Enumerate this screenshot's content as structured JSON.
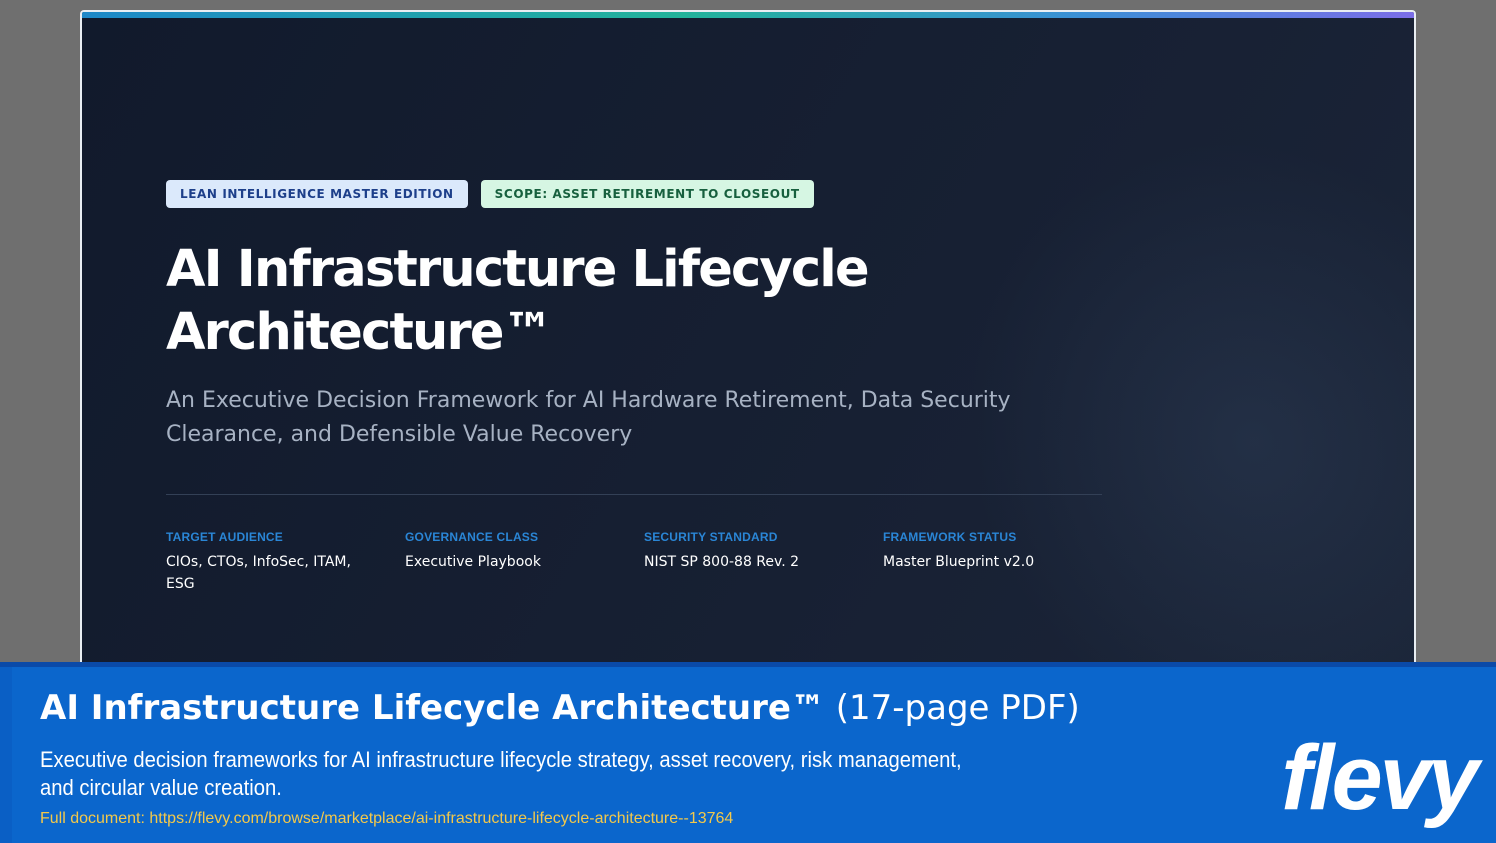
{
  "slide": {
    "tags": [
      {
        "label": "LEAN INTELLIGENCE MASTER EDITION"
      },
      {
        "label": "SCOPE: ASSET RETIREMENT TO CLOSEOUT"
      }
    ],
    "title_line1": "AI Infrastructure Lifecycle",
    "title_line2": "Architecture™",
    "subtitle": "An Executive Decision Framework for AI Hardware Retirement, Data Security Clearance, and Defensible Value Recovery",
    "meta": [
      {
        "label": "TARGET AUDIENCE",
        "value": "CIOs, CTOs, InfoSec, ITAM, ESG"
      },
      {
        "label": "GOVERNANCE CLASS",
        "value": "Executive Playbook"
      },
      {
        "label": "SECURITY STANDARD",
        "value": "NIST SP 800-88 Rev. 2"
      },
      {
        "label": "FRAMEWORK STATUS",
        "value": "Master Blueprint v2.0"
      }
    ]
  },
  "banner": {
    "title": "AI Infrastructure Lifecycle Architecture™",
    "title_suffix": " (17-page PDF)",
    "description": "Executive decision frameworks for AI infrastructure lifecycle strategy, asset recovery, risk management, and circular value creation.",
    "link_text": "Full document: https://flevy.com/browse/marketplace/ai-infrastructure-lifecycle-architecture--13764",
    "logo_text": "flevy"
  },
  "colors": {
    "slide_background": "#131c2e",
    "tag_blue": "#dbe9fb",
    "tag_green": "#d6f6e3",
    "meta_label": "#2a86d6",
    "banner_background": "#0b66cc",
    "link": "#f3c84a"
  }
}
